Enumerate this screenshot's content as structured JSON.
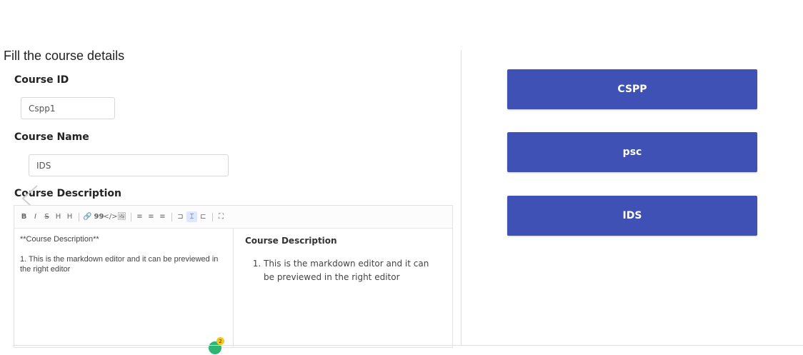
{
  "form": {
    "title": "Fill the course details",
    "course_id": {
      "label": "Course ID",
      "value": "Cspp1"
    },
    "course_name": {
      "label": "Course Name",
      "value": "IDS"
    },
    "course_description": {
      "label": "Course Description",
      "toolbar": [
        "B",
        "I",
        "S",
        "H",
        "H",
        "🔗",
        "99",
        "</>",
        "🖼",
        "≡",
        "≡",
        "≡",
        "⊐",
        "⌶",
        "⊏",
        "⛶"
      ],
      "markdown_lines": [
        "**Course Description**",
        "1. This is the markdown editor and it can be previewed in the right editor"
      ],
      "preview": {
        "heading": "Course Description",
        "items": [
          "This is the markdown editor and it can be previewed in the right editor"
        ]
      },
      "badge_count": "2"
    }
  },
  "courses": [
    {
      "label": "CSPP"
    },
    {
      "label": "psc"
    },
    {
      "label": "IDS"
    }
  ],
  "colors": {
    "button": "#3f51b5",
    "badge": "#2bb673",
    "badge_count": "#f3c623"
  }
}
